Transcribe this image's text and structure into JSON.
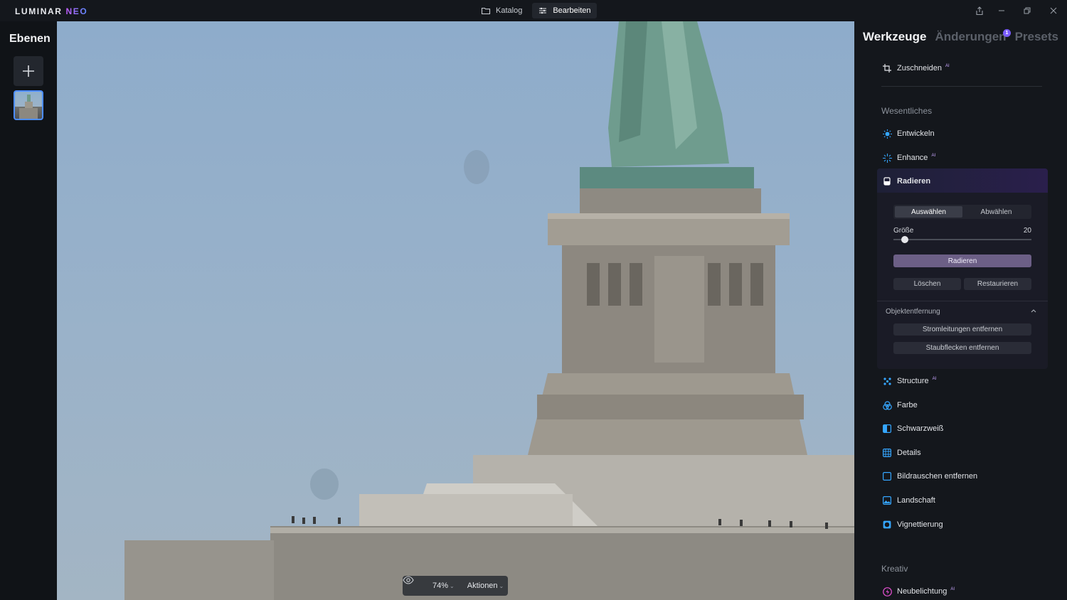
{
  "app": {
    "logo_main": "LUMINAR",
    "logo_neo": "NEO"
  },
  "topbar": {
    "tabs": [
      {
        "label": "Katalog",
        "icon": "folder-icon"
      },
      {
        "label": "Bearbeiten",
        "icon": "sliders-icon"
      }
    ],
    "window_controls": [
      "share-icon",
      "minimize-icon",
      "restore-icon",
      "close-icon"
    ]
  },
  "left_panel": {
    "title": "Ebenen",
    "add_icon": "plus-icon"
  },
  "canvas": {
    "zoom": "74%",
    "actions_label": "Aktionen",
    "eye_icon": "eye-icon"
  },
  "right_panel": {
    "tabs": [
      "Werkzeuge",
      "Änderungen",
      "Presets"
    ],
    "changes_badge": "1",
    "crop": {
      "label": "Zuschneiden",
      "ai": "AI"
    },
    "section_essentials": "Wesentliches",
    "tools_top": [
      {
        "label": "Entwickeln",
        "icon": "sun-icon",
        "ai": ""
      },
      {
        "label": "Enhance",
        "icon": "sparkle-icon",
        "ai": "AI"
      }
    ],
    "radieren": {
      "title": "Radieren",
      "icon": "eraser-icon",
      "select_label": "Auswählen",
      "deselect_label": "Abwählen",
      "size_label": "Größe",
      "size_value": "20",
      "size_fraction": 0.08,
      "erase_button": "Radieren",
      "delete_button": "Löschen",
      "restore_button": "Restaurieren",
      "object_removal_title": "Objektentfernung",
      "remove_powerlines": "Stromleitungen entfernen",
      "remove_dust": "Staubflecken entfernen"
    },
    "tools_bottom": [
      {
        "label": "Structure",
        "icon": "structure-icon",
        "ai": "AI"
      },
      {
        "label": "Farbe",
        "icon": "color-icon",
        "ai": ""
      },
      {
        "label": "Schwarzweiß",
        "icon": "bw-icon",
        "ai": ""
      },
      {
        "label": "Details",
        "icon": "details-icon",
        "ai": ""
      },
      {
        "label": "Bildrauschen entfernen",
        "icon": "noise-icon",
        "ai": ""
      },
      {
        "label": "Landschaft",
        "icon": "landscape-icon",
        "ai": ""
      },
      {
        "label": "Vignettierung",
        "icon": "vignette-icon",
        "ai": ""
      }
    ],
    "section_creative": "Kreativ",
    "creative_tools": [
      {
        "label": "Neubelichtung",
        "icon": "relight-icon",
        "ai": "AI"
      }
    ]
  },
  "colors": {
    "accent": "#4c8dff",
    "ai_badge": "#c9a6ff",
    "primary_button": "#6c5f86"
  }
}
